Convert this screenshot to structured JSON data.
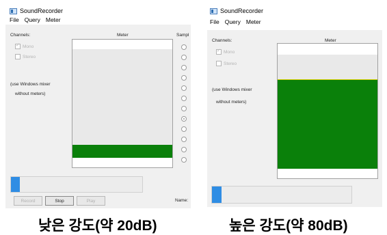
{
  "left": {
    "window": {
      "title": "SoundRecorder",
      "menu": [
        "File",
        "Query",
        "Meter"
      ],
      "channels_label": "Channels:",
      "meter_label": "Meter",
      "sample_label": "Sampl",
      "mono_label": "Mono",
      "stereo_label": "Stereo",
      "mixer_note_1": "(use Windows mixer",
      "mixer_note_2": "without meters)",
      "buttons": {
        "record": "Record",
        "stop": "Stop",
        "play": "Play"
      },
      "name_label": "Name:",
      "meter_level": 0.11,
      "progress_level": 0.07
    },
    "caption": "낮은 강도(약 20dB)"
  },
  "right": {
    "window": {
      "title": "SoundRecorder",
      "menu": [
        "File",
        "Query",
        "Meter"
      ],
      "channels_label": "Channels:",
      "meter_label": "Meter",
      "mono_label": "Mono",
      "stereo_label": "Stereo",
      "mixer_note_1": "(use Windows mixer",
      "mixer_note_2": "without meters)",
      "meter_level": 0.71,
      "progress_level": 0.07
    },
    "caption": "높은 강도(약 80dB)"
  },
  "colors": {
    "meter_fill": "#0a800a",
    "meter_peak": "#d6d000",
    "progress_fill": "#2f8de4",
    "window_bg": "#f0f0f0"
  }
}
